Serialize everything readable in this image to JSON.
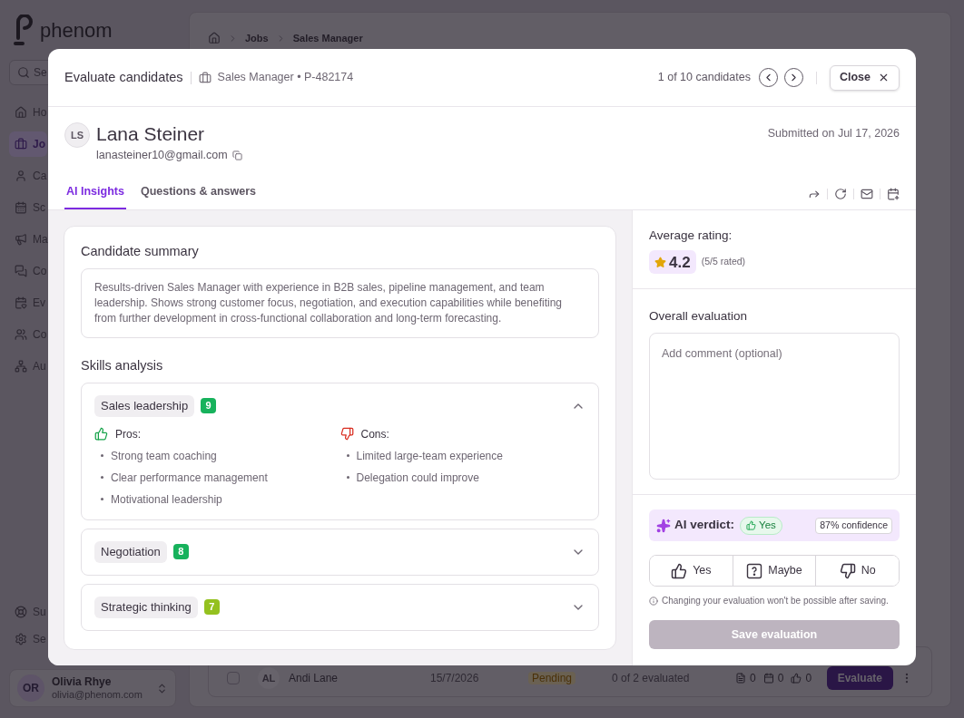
{
  "sidebar": {
    "logo": "phenom",
    "search_placeholder": "Se",
    "items": [
      {
        "label": "Ho",
        "selected": false
      },
      {
        "label": "Jo",
        "selected": true
      },
      {
        "label": "Ca",
        "selected": false
      },
      {
        "label": "Sc",
        "selected": false
      },
      {
        "label": "Ma",
        "selected": false
      },
      {
        "label": "Co",
        "selected": false
      },
      {
        "label": "Ev",
        "selected": false
      },
      {
        "label": "Co",
        "selected": false
      },
      {
        "label": "Au",
        "selected": false
      }
    ],
    "footer_items": [
      "Su",
      "Se"
    ],
    "user": {
      "initials": "OR",
      "name": "Olivia Rhye",
      "email": "olivia@phenom.com"
    }
  },
  "breadcrumb": [
    "Jobs",
    "Sales Manager"
  ],
  "table_row": {
    "checked": false,
    "initials": "AL",
    "name": "Andi Lane",
    "date": "15/7/2026",
    "status": "Pending",
    "progress": "0 of 2 evaluated",
    "counts": [
      "0",
      "0",
      "0"
    ],
    "action": "Evaluate"
  },
  "modal": {
    "title": "Evaluate candidates",
    "job": "Sales Manager • P-482174",
    "counter": "1 of 10 candidates",
    "close": "Close",
    "candidate": {
      "initials": "LS",
      "name": "Lana Steiner",
      "email": "lanasteiner10@gmail.com",
      "submitted": "Submitted on Jul 17, 2026"
    },
    "tabs": [
      {
        "label": "AI Insights",
        "selected": true
      },
      {
        "label": "Questions & answers",
        "selected": false
      }
    ],
    "summary": {
      "title": "Candidate summary",
      "text": "Results-driven Sales Manager with experience in B2B sales, pipeline management, and team leadership. Shows strong customer focus, negotiation, and execution capabilities while benefiting from further development in cross-functional collaboration and long-term forecasting."
    },
    "skills": {
      "title": "Skills analysis",
      "items": [
        {
          "name": "Sales leadership",
          "score": "9",
          "color": "#17b25c",
          "expanded": true,
          "pros_label": "Pros:",
          "pros": [
            "Strong team coaching",
            "Clear performance management",
            "Motivational leadership"
          ],
          "cons_label": "Cons:",
          "cons": [
            "Limited large-team experience",
            "Delegation could improve"
          ]
        },
        {
          "name": "Negotiation",
          "score": "8",
          "color": "#17b25c",
          "expanded": false
        },
        {
          "name": "Strategic thinking",
          "score": "7",
          "color": "#94c11f",
          "expanded": false
        }
      ]
    },
    "rating": {
      "title": "Average rating:",
      "value": "4.2",
      "note": "(5/5 rated)"
    },
    "evaluation": {
      "title": "Overall evaluation",
      "placeholder": "Add comment (optional)",
      "ai_label": "AI verdict:",
      "ai_verdict": "Yes",
      "confidence": "87% confidence",
      "options": [
        {
          "label": "Yes",
          "selected": false
        },
        {
          "label": "Maybe",
          "selected": false
        },
        {
          "label": "No",
          "selected": false
        }
      ],
      "note": "Changing your evaluation won't be possible after saving.",
      "save": "Save evaluation",
      "save_disabled": true
    }
  }
}
